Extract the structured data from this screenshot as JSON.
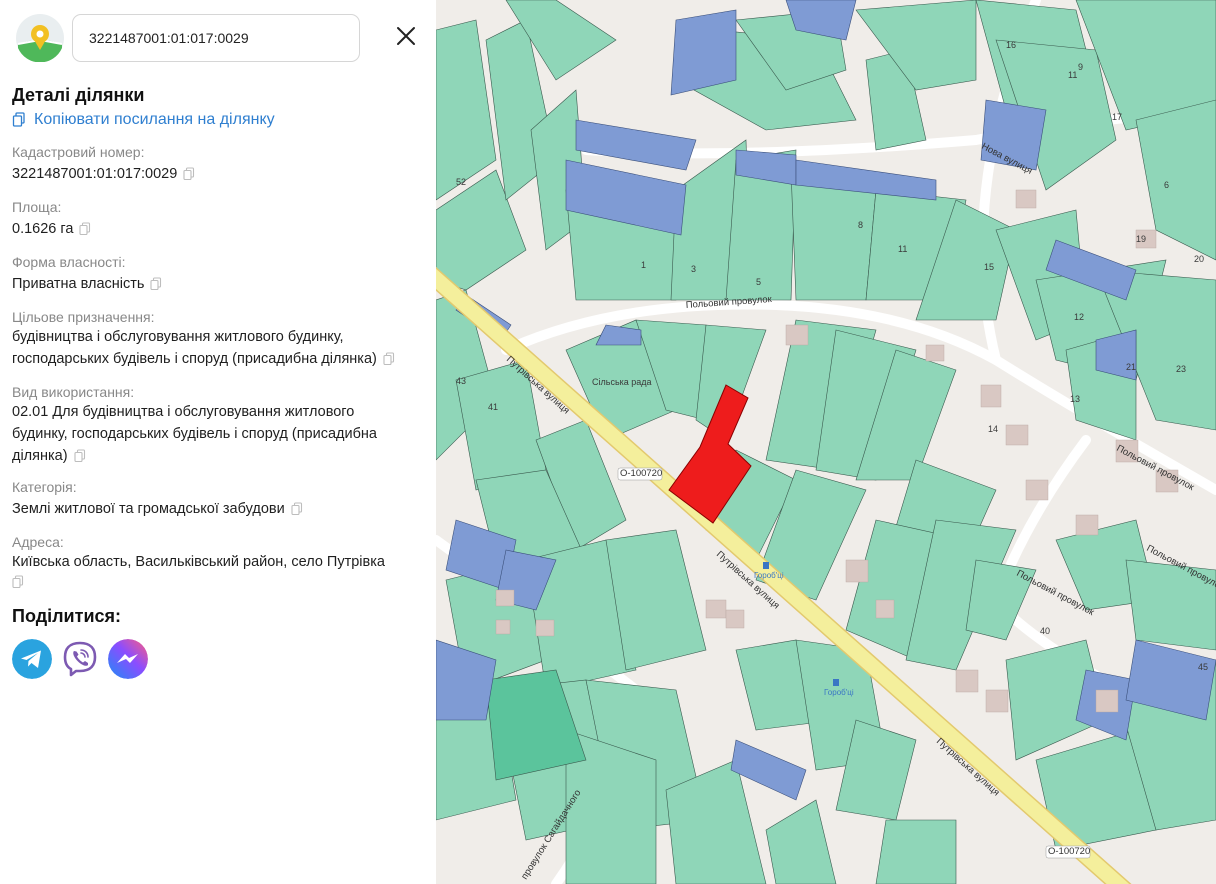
{
  "search": {
    "value": "3221487001:01:017:0029"
  },
  "details": {
    "title": "Деталі ділянки",
    "copy_link_label": "Копіювати посилання на ділянку",
    "fields": [
      {
        "label": "Кадастровий номер:",
        "value": "3221487001:01:017:0029"
      },
      {
        "label": "Площа:",
        "value": "0.1626 га"
      },
      {
        "label": "Форма власності:",
        "value": "Приватна власність"
      },
      {
        "label": "Цільове призначення:",
        "value_lines": [
          "будівництва і обслуговування житлового будинку,",
          "господарських будівель і споруд (присадибна ділянка)"
        ]
      },
      {
        "label": "Вид використання:",
        "value_lines": [
          "02.01 Для будівництва і обслуговування житлового",
          "будинку, господарських будівель і споруд (присадибна",
          "ділянка)"
        ]
      },
      {
        "label": "Категорія:",
        "value": "Землі житлової та громадської забудови"
      },
      {
        "label": "Адреса:",
        "value": "Київська область, Васильківський район, село Путрівка"
      }
    ]
  },
  "share": {
    "title": "Поділитися:",
    "buttons": [
      {
        "icon": "telegram-icon",
        "color": "#2aa3df"
      },
      {
        "icon": "viber-icon",
        "color": "#7d5ab2"
      },
      {
        "icon": "messenger-icon",
        "color": "#3f7cf5"
      }
    ]
  },
  "map": {
    "colors": {
      "parcel": "#8fd6b8",
      "parcel_state": "#7f9bd4",
      "selected": "#ee1c1c",
      "main_road": "#f4ef9c",
      "background": "#f0ede9"
    },
    "streets": [
      "Путрівська вулиця",
      "Путрівська вулиця",
      "Путрівська вулиця",
      "Польовий провулок",
      "Польовий провулок",
      "Польовий провулок",
      "Польовий провулок",
      "Нова вулиця",
      "провулок Сагайдачного"
    ],
    "road_refs": [
      "О-100720",
      "О-100720"
    ],
    "places": [
      "Сільська рада"
    ],
    "bus_stops": [
      "Гороб'ці",
      "Гороб'ці"
    ],
    "house_numbers": [
      "1",
      "3",
      "5",
      "6",
      "8",
      "9",
      "11",
      "11",
      "12",
      "13",
      "14",
      "15",
      "16",
      "17",
      "19",
      "20",
      "21",
      "23",
      "40",
      "41",
      "43",
      "45",
      "52"
    ]
  }
}
